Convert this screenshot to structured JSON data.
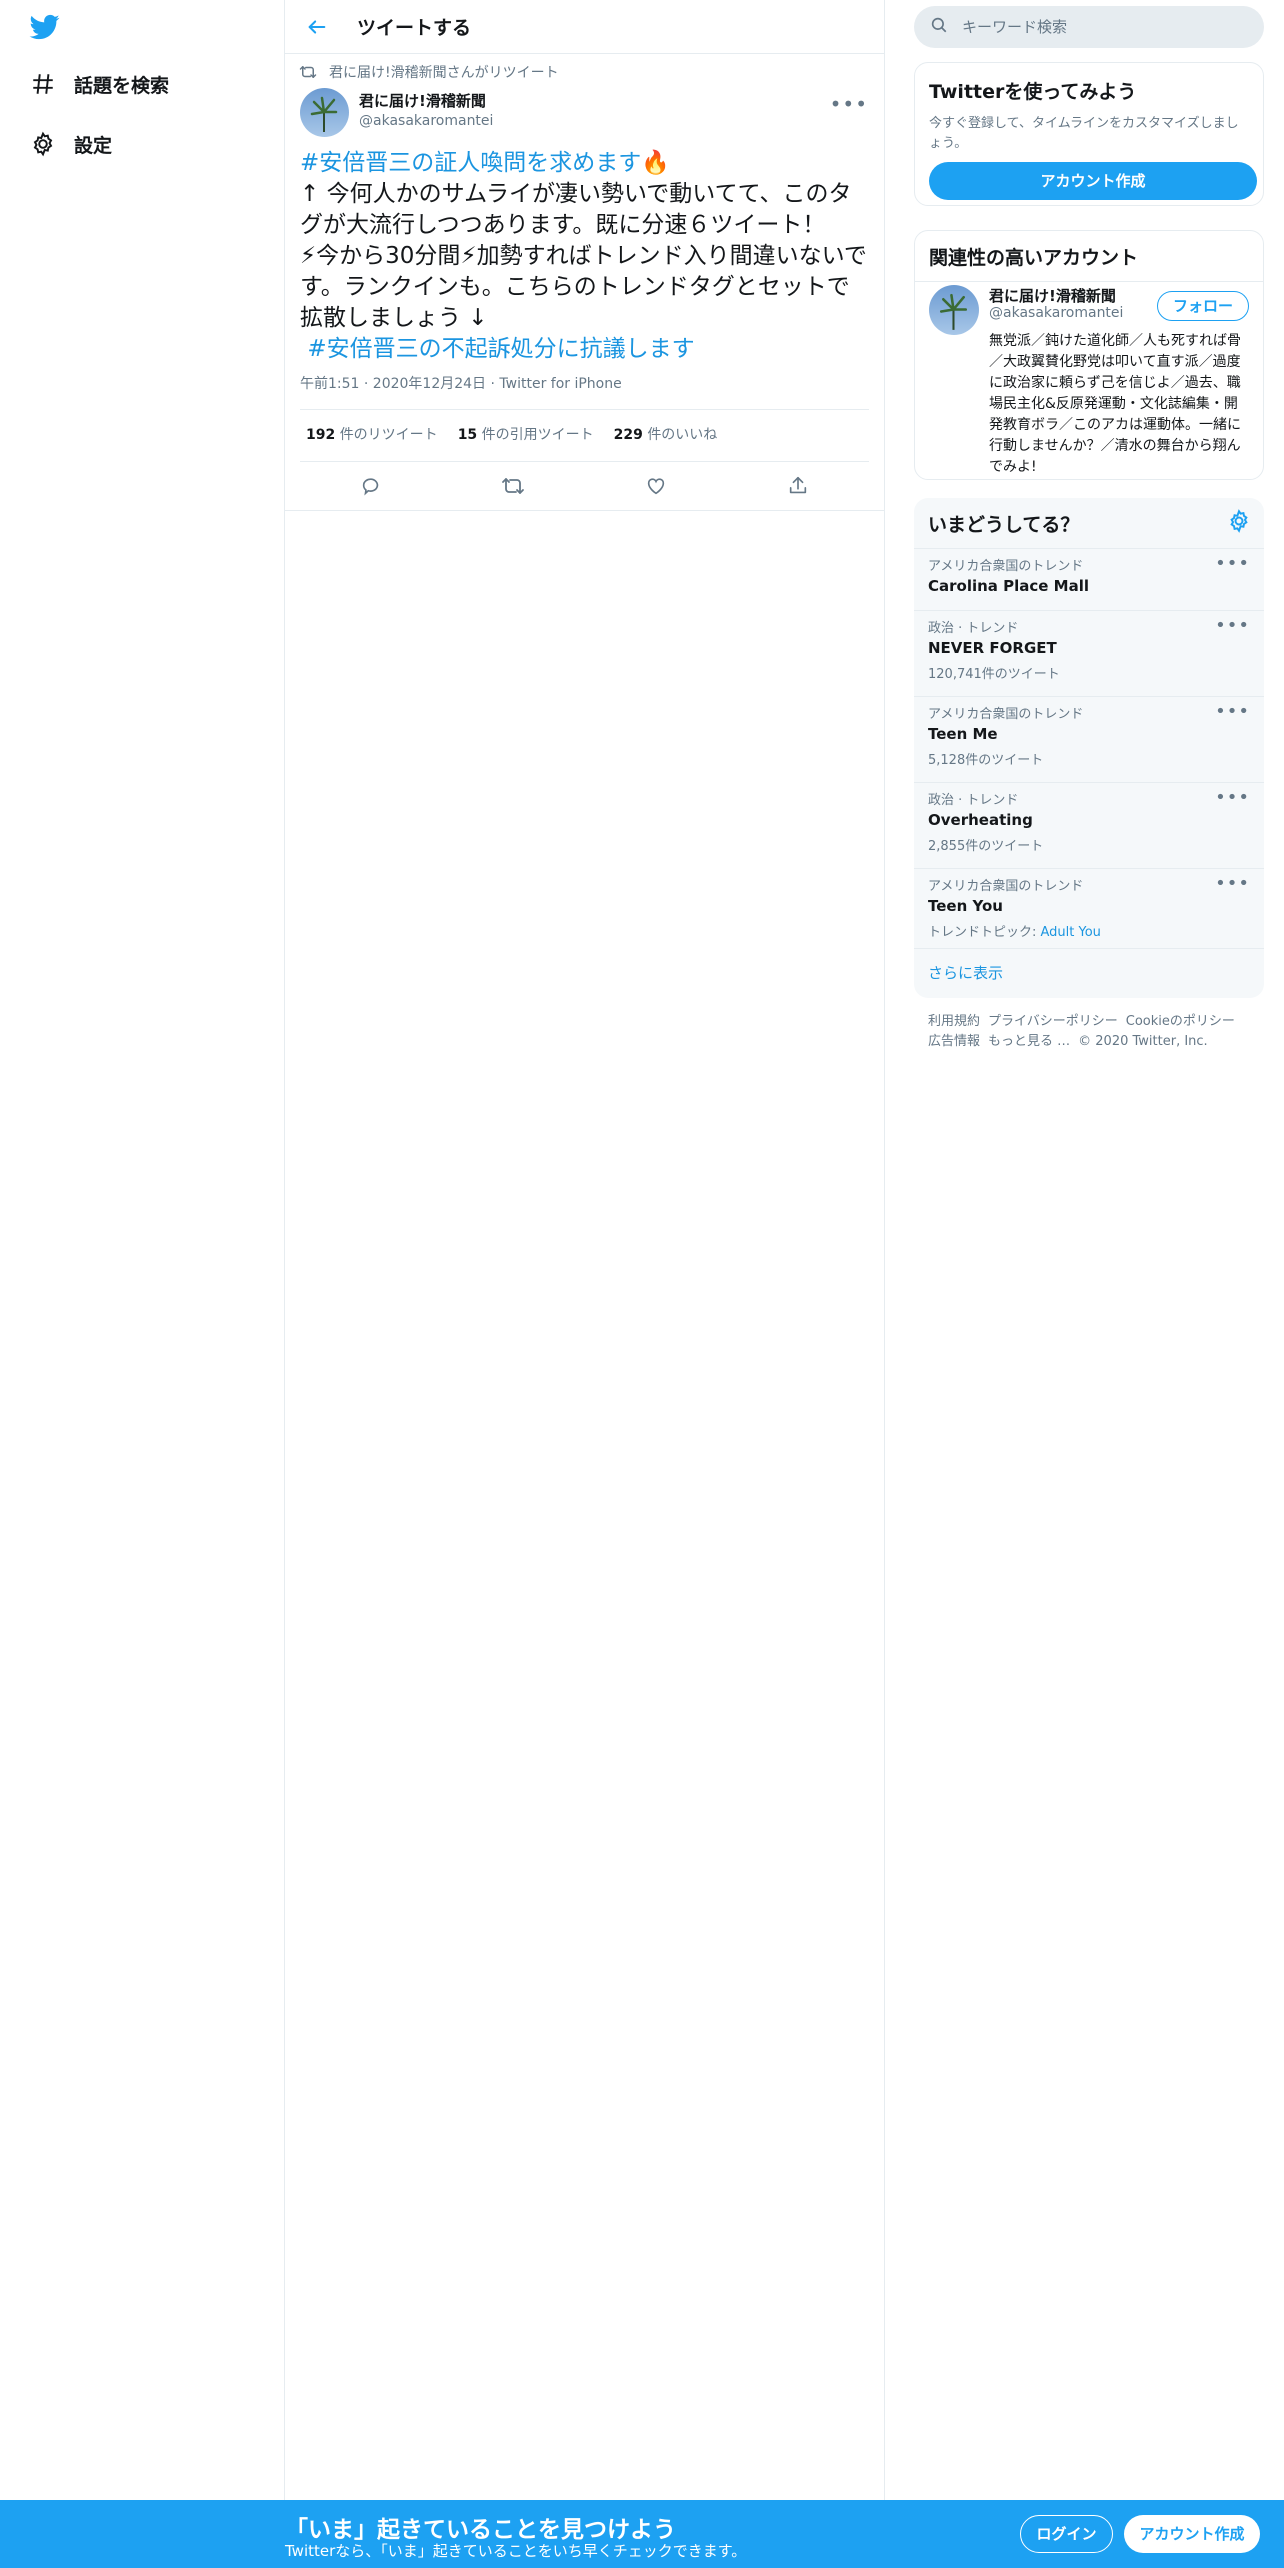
{
  "nav": {
    "explore_label": "話題を検索",
    "settings_label": "設定"
  },
  "header": {
    "title": "ツイートする"
  },
  "tweet": {
    "retweet_context": "君に届け!滑稽新聞さんがリツイート",
    "author_name": "君に届け!滑稽新聞",
    "author_handle": "@akasakaromantei",
    "hashtag_1": "#安倍晋三の証人喚問を求めます",
    "emoji_fire": "🔥",
    "text_line_1": "↑ 今何人かのサムライが凄い勢いで動いてて、このタグが大流行しつつあります。既に分速６ツイート！",
    "emoji_bolt": "⚡",
    "text_line_2a": "今から30分間",
    "text_line_2b": "加勢すればトレンド入り間違いないです。ランクインも。こちらのトレンドタグとセットで拡散しましょう ↓",
    "hashtag_2": "#安倍晋三の不起訴処分に抗議します",
    "meta": "午前1:51 · 2020年12月24日 · Twitter for iPhone",
    "retweets_count": "192",
    "retweets_label": "件のリツイート",
    "quotes_count": "15",
    "quotes_label": "件の引用ツイート",
    "likes_count": "229",
    "likes_label": "件のいいね"
  },
  "search": {
    "placeholder": "キーワード検索"
  },
  "signup_card": {
    "title": "Twitterを使ってみよう",
    "description": "今すぐ登録して、タイムラインをカスタマイズしましょう。",
    "button": "アカウント作成"
  },
  "related_card": {
    "title": "関連性の高いアカウント",
    "name": "君に届け!滑稽新聞",
    "handle": "@akasakaromantei",
    "follow": "フォロー",
    "bio": "無党派／鈍けた道化師／人も死すれば骨／大政翼賛化野党は叩いて直す派／過度に政治家に頼らず己を信じよ／過去、職場民主化&反原発運動・文化誌編集・開発教育ボラ／このアカは運動体。一緒に行動しませんか？／清水の舞台から翔んでみよ!"
  },
  "trends": {
    "title": "いまどうしてる？",
    "items": [
      {
        "context": "アメリカ合衆国のトレンド",
        "name": "Carolina Place Mall",
        "sub": ""
      },
      {
        "context": "政治 · トレンド",
        "name": "NEVER FORGET",
        "sub": "120,741件のツイート"
      },
      {
        "context": "アメリカ合衆国のトレンド",
        "name": "Teen Me",
        "sub": "5,128件のツイート"
      },
      {
        "context": "政治 · トレンド",
        "name": "Overheating",
        "sub": "2,855件のツイート"
      },
      {
        "context": "アメリカ合衆国のトレンド",
        "name": "Teen You",
        "sub": "トレンドトピック: ",
        "sub_link": "Adult You"
      }
    ],
    "show_more": "さらに表示"
  },
  "footer": {
    "terms": "利用規約",
    "privacy": "プライバシーポリシー",
    "cookie": "Cookieのポリシー",
    "ads": "広告情報",
    "more": "もっと見る …",
    "copyright": "© 2020 Twitter, Inc."
  },
  "banner": {
    "title": "「いま」起きていることを見つけよう",
    "subtitle": "Twitterなら、「いま」起きていることをいち早くチェックできます。",
    "login": "ログイン",
    "signup": "アカウント作成"
  },
  "colors": {
    "brand": "#1da1f2",
    "link": "#1b95e0",
    "muted": "#657786",
    "border": "#e6ecf0"
  }
}
